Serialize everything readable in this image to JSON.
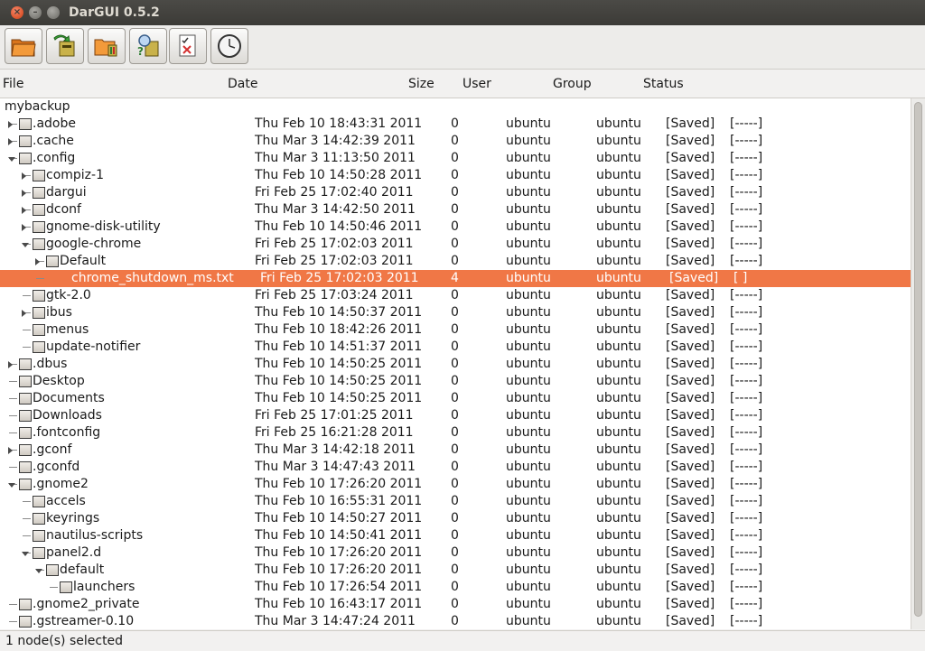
{
  "window": {
    "title": "DarGUI 0.5.2"
  },
  "toolbar": {
    "buttons": [
      {
        "name": "open-archive-button",
        "icon": "folder-open-icon"
      },
      {
        "name": "restore-button",
        "icon": "restore-archive-icon"
      },
      {
        "name": "create-backup-button",
        "icon": "folder-backup-icon"
      },
      {
        "name": "diff-backup-button",
        "icon": "search-archive-icon"
      },
      {
        "name": "test-archive-button",
        "icon": "checklist-icon"
      },
      {
        "name": "schedule-button",
        "icon": "clock-icon"
      }
    ]
  },
  "columns": {
    "file": "File",
    "date": "Date",
    "size": "Size",
    "user": "User",
    "group": "Group",
    "status": "Status"
  },
  "root": "mybackup",
  "rows": [
    {
      "name": ".adobe",
      "depth": 0,
      "exp": "closed",
      "date": "Thu Feb 10 18:43:31 2011",
      "size": "0",
      "user": "ubuntu",
      "group": "ubuntu",
      "status": "[Saved]",
      "flag": "[-----]"
    },
    {
      "name": ".cache",
      "depth": 0,
      "exp": "closed",
      "date": "Thu Mar  3 14:42:39 2011",
      "size": "0",
      "user": "ubuntu",
      "group": "ubuntu",
      "status": "[Saved]",
      "flag": "[-----]"
    },
    {
      "name": ".config",
      "depth": 0,
      "exp": "open",
      "date": "Thu Mar  3 11:13:50 2011",
      "size": "0",
      "user": "ubuntu",
      "group": "ubuntu",
      "status": "[Saved]",
      "flag": "[-----]"
    },
    {
      "name": "compiz-1",
      "depth": 1,
      "exp": "closed",
      "date": "Thu Feb 10 14:50:28 2011",
      "size": "0",
      "user": "ubuntu",
      "group": "ubuntu",
      "status": "[Saved]",
      "flag": "[-----]"
    },
    {
      "name": "dargui",
      "depth": 1,
      "exp": "closed",
      "date": "Fri Feb 25 17:02:40 2011",
      "size": "0",
      "user": "ubuntu",
      "group": "ubuntu",
      "status": "[Saved]",
      "flag": "[-----]"
    },
    {
      "name": "dconf",
      "depth": 1,
      "exp": "closed",
      "date": "Thu Mar  3 14:42:50 2011",
      "size": "0",
      "user": "ubuntu",
      "group": "ubuntu",
      "status": "[Saved]",
      "flag": "[-----]"
    },
    {
      "name": "gnome-disk-utility",
      "depth": 1,
      "exp": "closed",
      "date": "Thu Feb 10 14:50:46 2011",
      "size": "0",
      "user": "ubuntu",
      "group": "ubuntu",
      "status": "[Saved]",
      "flag": "[-----]"
    },
    {
      "name": "google-chrome",
      "depth": 1,
      "exp": "open",
      "date": "Fri Feb 25 17:02:03 2011",
      "size": "0",
      "user": "ubuntu",
      "group": "ubuntu",
      "status": "[Saved]",
      "flag": "[-----]"
    },
    {
      "name": "Default",
      "depth": 2,
      "exp": "closed",
      "date": "Fri Feb 25 17:02:03 2011",
      "size": "0",
      "user": "ubuntu",
      "group": "ubuntu",
      "status": "[Saved]",
      "flag": "[-----]"
    },
    {
      "name": "chrome_shutdown_ms.txt",
      "depth": 2,
      "exp": "none",
      "file": true,
      "selected": true,
      "date": "Fri Feb 25 17:02:03 2011",
      "size": "4",
      "user": "ubuntu",
      "group": "ubuntu",
      "status": "[Saved]",
      "flag": "[   ]"
    },
    {
      "name": "gtk-2.0",
      "depth": 1,
      "exp": "none",
      "date": "Fri Feb 25 17:03:24 2011",
      "size": "0",
      "user": "ubuntu",
      "group": "ubuntu",
      "status": "[Saved]",
      "flag": "[-----]"
    },
    {
      "name": "ibus",
      "depth": 1,
      "exp": "closed",
      "date": "Thu Feb 10 14:50:37 2011",
      "size": "0",
      "user": "ubuntu",
      "group": "ubuntu",
      "status": "[Saved]",
      "flag": "[-----]"
    },
    {
      "name": "menus",
      "depth": 1,
      "exp": "none",
      "date": "Thu Feb 10 18:42:26 2011",
      "size": "0",
      "user": "ubuntu",
      "group": "ubuntu",
      "status": "[Saved]",
      "flag": "[-----]"
    },
    {
      "name": "update-notifier",
      "depth": 1,
      "exp": "none",
      "date": "Thu Feb 10 14:51:37 2011",
      "size": "0",
      "user": "ubuntu",
      "group": "ubuntu",
      "status": "[Saved]",
      "flag": "[-----]"
    },
    {
      "name": ".dbus",
      "depth": 0,
      "exp": "closed",
      "date": "Thu Feb 10 14:50:25 2011",
      "size": "0",
      "user": "ubuntu",
      "group": "ubuntu",
      "status": "[Saved]",
      "flag": "[-----]"
    },
    {
      "name": "Desktop",
      "depth": 0,
      "exp": "none",
      "date": "Thu Feb 10 14:50:25 2011",
      "size": "0",
      "user": "ubuntu",
      "group": "ubuntu",
      "status": "[Saved]",
      "flag": "[-----]"
    },
    {
      "name": "Documents",
      "depth": 0,
      "exp": "none",
      "date": "Thu Feb 10 14:50:25 2011",
      "size": "0",
      "user": "ubuntu",
      "group": "ubuntu",
      "status": "[Saved]",
      "flag": "[-----]"
    },
    {
      "name": "Downloads",
      "depth": 0,
      "exp": "none",
      "date": "Fri Feb 25 17:01:25 2011",
      "size": "0",
      "user": "ubuntu",
      "group": "ubuntu",
      "status": "[Saved]",
      "flag": "[-----]"
    },
    {
      "name": ".fontconfig",
      "depth": 0,
      "exp": "none",
      "date": "Fri Feb 25 16:21:28 2011",
      "size": "0",
      "user": "ubuntu",
      "group": "ubuntu",
      "status": "[Saved]",
      "flag": "[-----]"
    },
    {
      "name": ".gconf",
      "depth": 0,
      "exp": "closed",
      "date": "Thu Mar  3 14:42:18 2011",
      "size": "0",
      "user": "ubuntu",
      "group": "ubuntu",
      "status": "[Saved]",
      "flag": "[-----]"
    },
    {
      "name": ".gconfd",
      "depth": 0,
      "exp": "none",
      "date": "Thu Mar  3 14:47:43 2011",
      "size": "0",
      "user": "ubuntu",
      "group": "ubuntu",
      "status": "[Saved]",
      "flag": "[-----]"
    },
    {
      "name": ".gnome2",
      "depth": 0,
      "exp": "open",
      "date": "Thu Feb 10 17:26:20 2011",
      "size": "0",
      "user": "ubuntu",
      "group": "ubuntu",
      "status": "[Saved]",
      "flag": "[-----]"
    },
    {
      "name": "accels",
      "depth": 1,
      "exp": "none",
      "date": "Thu Feb 10 16:55:31 2011",
      "size": "0",
      "user": "ubuntu",
      "group": "ubuntu",
      "status": "[Saved]",
      "flag": "[-----]"
    },
    {
      "name": "keyrings",
      "depth": 1,
      "exp": "none",
      "date": "Thu Feb 10 14:50:27 2011",
      "size": "0",
      "user": "ubuntu",
      "group": "ubuntu",
      "status": "[Saved]",
      "flag": "[-----]"
    },
    {
      "name": "nautilus-scripts",
      "depth": 1,
      "exp": "none",
      "date": "Thu Feb 10 14:50:41 2011",
      "size": "0",
      "user": "ubuntu",
      "group": "ubuntu",
      "status": "[Saved]",
      "flag": "[-----]"
    },
    {
      "name": "panel2.d",
      "depth": 1,
      "exp": "open",
      "date": "Thu Feb 10 17:26:20 2011",
      "size": "0",
      "user": "ubuntu",
      "group": "ubuntu",
      "status": "[Saved]",
      "flag": "[-----]"
    },
    {
      "name": "default",
      "depth": 2,
      "exp": "open",
      "date": "Thu Feb 10 17:26:20 2011",
      "size": "0",
      "user": "ubuntu",
      "group": "ubuntu",
      "status": "[Saved]",
      "flag": "[-----]"
    },
    {
      "name": "launchers",
      "depth": 3,
      "exp": "none",
      "date": "Thu Feb 10 17:26:54 2011",
      "size": "0",
      "user": "ubuntu",
      "group": "ubuntu",
      "status": "[Saved]",
      "flag": "[-----]"
    },
    {
      "name": ".gnome2_private",
      "depth": 0,
      "exp": "none",
      "date": "Thu Feb 10 16:43:17 2011",
      "size": "0",
      "user": "ubuntu",
      "group": "ubuntu",
      "status": "[Saved]",
      "flag": "[-----]"
    },
    {
      "name": ".gstreamer-0.10",
      "depth": 0,
      "exp": "none",
      "date": "Thu Mar  3 14:47:24 2011",
      "size": "0",
      "user": "ubuntu",
      "group": "ubuntu",
      "status": "[Saved]",
      "flag": "[-----]"
    }
  ],
  "statusbar": {
    "text": "1 node(s) selected"
  },
  "colors": {
    "selection": "#f07746",
    "titlebar": "#3c3b37",
    "close_button": "#e05a32"
  }
}
